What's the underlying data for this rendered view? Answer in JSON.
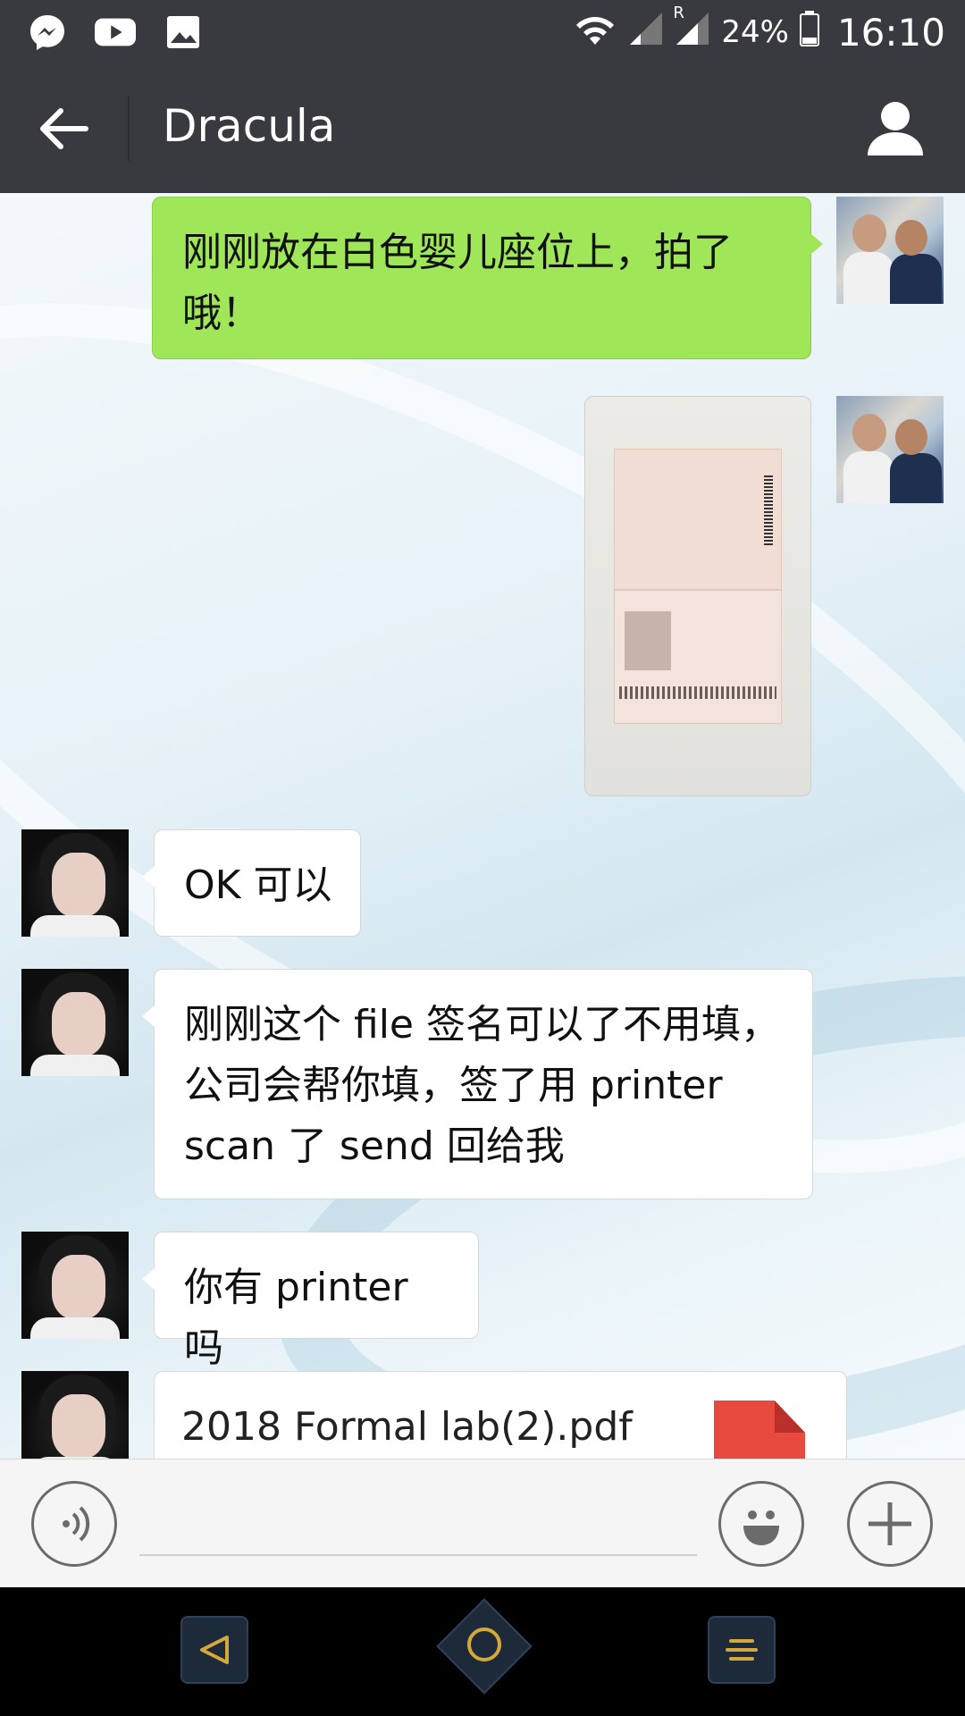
{
  "status_bar": {
    "battery_percent": "24%",
    "time": "16:10",
    "roaming": "R",
    "left_icons": [
      "messenger-icon",
      "youtube-icon",
      "gallery-icon"
    ],
    "right_icons": [
      "wifi-icon",
      "signal-icon",
      "signal-roaming-icon",
      "battery-icon"
    ]
  },
  "header": {
    "title": "Dracula"
  },
  "messages": [
    {
      "sender": "me",
      "type": "text",
      "text": "刚刚放在白色婴儿座位上，拍了哦！"
    },
    {
      "sender": "me",
      "type": "image",
      "description": "photo"
    },
    {
      "sender": "other",
      "type": "text",
      "text": "OK 可以"
    },
    {
      "sender": "other",
      "type": "text",
      "lines": [
        "刚刚这个 file 签名可以了不用填，",
        "公司会帮你填，签了用 printer",
        "scan 了 send 回给我"
      ]
    },
    {
      "sender": "other",
      "type": "text",
      "text": "你有 printer 吗"
    },
    {
      "sender": "other",
      "type": "file",
      "file_name": "2018 Formal lab(2).pdf",
      "file_icon": "pdf-icon"
    }
  ],
  "input_bar": {
    "placeholder": ""
  },
  "colors": {
    "bar_dark": "#393a3f",
    "bubble_me": "#9fe658",
    "bubble_other": "#ffffff",
    "pdf_red": "#e84a3f"
  }
}
